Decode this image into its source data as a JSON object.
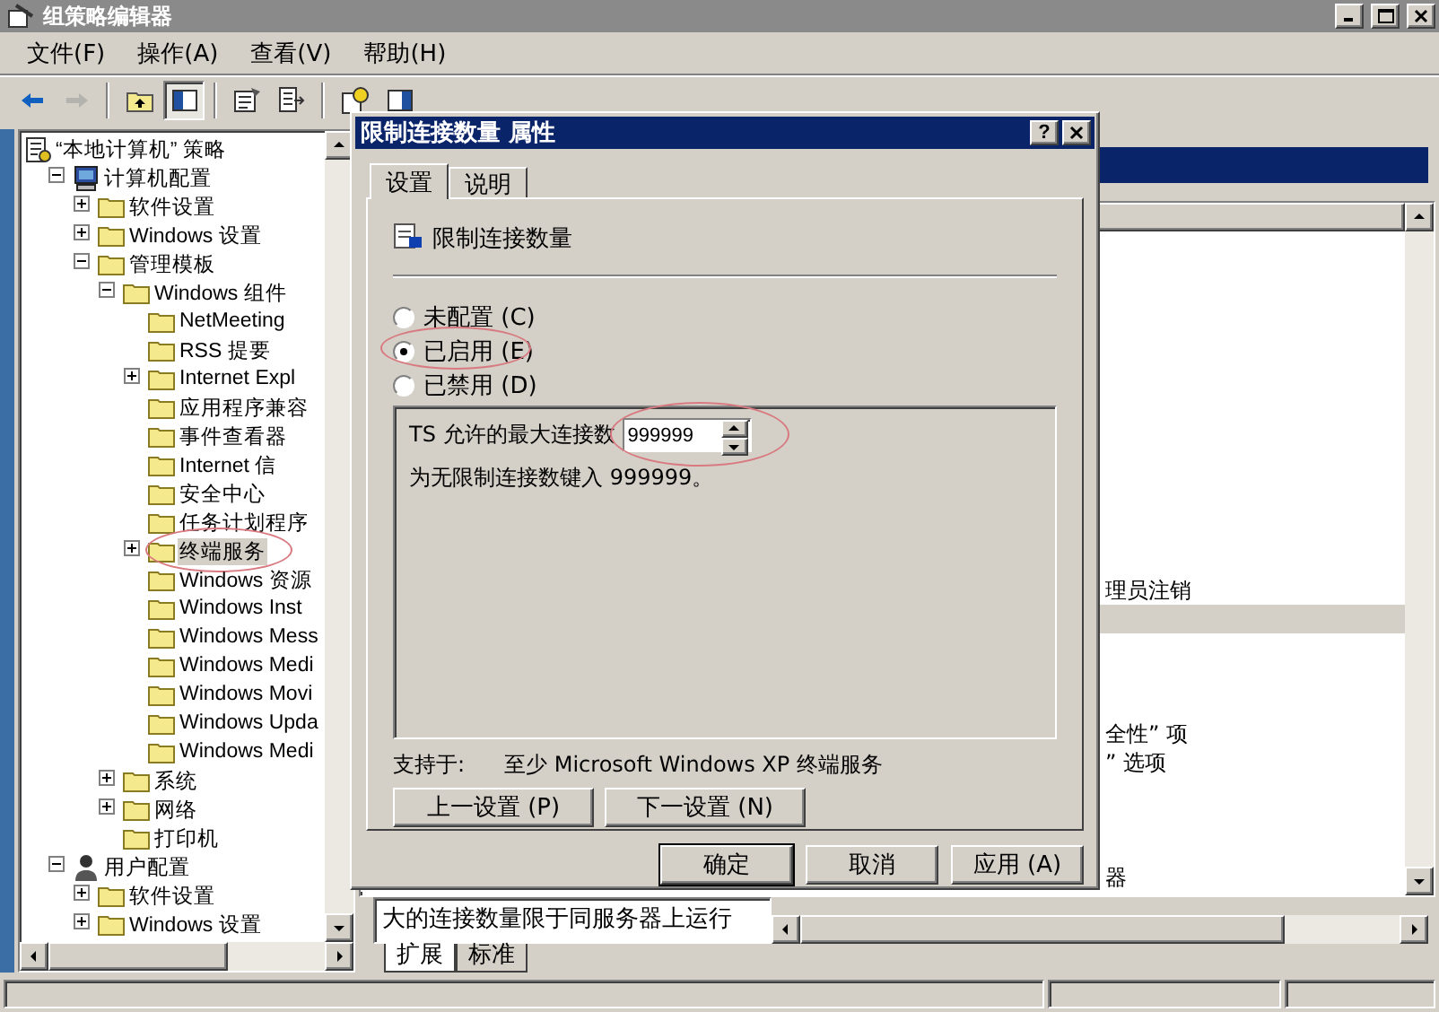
{
  "window": {
    "title": "组策略编辑器"
  },
  "menu": [
    "文件(F)",
    "操作(A)",
    "查看(V)",
    "帮助(H)"
  ],
  "toolbar": [
    [
      {
        "kind": "back",
        "disabled": false,
        "pressed": false
      },
      {
        "kind": "forward",
        "disabled": true,
        "pressed": false
      }
    ],
    [
      {
        "kind": "up",
        "disabled": false,
        "pressed": false
      },
      {
        "kind": "tree",
        "disabled": false,
        "pressed": true
      }
    ],
    [
      {
        "kind": "properties",
        "disabled": false,
        "pressed": false
      },
      {
        "kind": "export",
        "disabled": false,
        "pressed": false
      }
    ],
    [
      {
        "kind": "help",
        "disabled": false,
        "pressed": false
      },
      {
        "kind": "pane",
        "disabled": false,
        "pressed": false
      }
    ]
  ],
  "tree": [
    {
      "label": "“本地计算机” 策略",
      "kind": "policy",
      "selected": false,
      "children": [
        {
          "label": "计算机配置",
          "kind": "computer",
          "expanded": true,
          "selected": false,
          "children": [
            {
              "label": "软件设置",
              "kind": "folder",
              "expanded": false,
              "selected": false
            },
            {
              "label": "Windows 设置",
              "kind": "folder",
              "expanded": false,
              "selected": false
            },
            {
              "label": "管理模板",
              "kind": "folder",
              "expanded": true,
              "selected": false,
              "children": [
                {
                  "label": "Windows 组件",
                  "kind": "folder",
                  "expanded": true,
                  "selected": false,
                  "children": [
                    {
                      "label": "NetMeeting",
                      "kind": "folder",
                      "selected": false
                    },
                    {
                      "label": "RSS 提要",
                      "kind": "folder",
                      "selected": false
                    },
                    {
                      "label": "Internet Expl",
                      "kind": "folder",
                      "expanded": false,
                      "selected": false
                    },
                    {
                      "label": "应用程序兼容",
                      "kind": "folder",
                      "selected": false
                    },
                    {
                      "label": "事件查看器",
                      "kind": "folder",
                      "selected": false
                    },
                    {
                      "label": "Internet 信",
                      "kind": "folder",
                      "selected": false
                    },
                    {
                      "label": "安全中心",
                      "kind": "folder",
                      "selected": false
                    },
                    {
                      "label": "任务计划程序",
                      "kind": "folder",
                      "selected": false
                    },
                    {
                      "label": "终端服务",
                      "kind": "folder",
                      "expanded": false,
                      "selected": true
                    },
                    {
                      "label": "Windows 资源",
                      "kind": "folder",
                      "selected": false
                    },
                    {
                      "label": "Windows Inst",
                      "kind": "folder",
                      "selected": false
                    },
                    {
                      "label": "Windows Mess",
                      "kind": "folder",
                      "selected": false
                    },
                    {
                      "label": "Windows Medi",
                      "kind": "folder",
                      "selected": false
                    },
                    {
                      "label": "Windows Movi",
                      "kind": "folder",
                      "selected": false
                    },
                    {
                      "label": "Windows Upda",
                      "kind": "folder",
                      "selected": false
                    },
                    {
                      "label": "Windows Medi",
                      "kind": "folder",
                      "selected": false
                    }
                  ]
                },
                {
                  "label": "系统",
                  "kind": "folder",
                  "expanded": false,
                  "selected": false
                },
                {
                  "label": "网络",
                  "kind": "folder",
                  "expanded": false,
                  "selected": false
                },
                {
                  "label": "打印机",
                  "kind": "folder",
                  "selected": false
                }
              ]
            }
          ]
        },
        {
          "label": "用户配置",
          "kind": "user",
          "expanded": true,
          "selected": false,
          "children": [
            {
              "label": "软件设置",
              "kind": "folder",
              "expanded": false,
              "selected": false
            },
            {
              "label": "Windows 设置",
              "kind": "folder",
              "expanded": false,
              "selected": false
            }
          ]
        }
      ]
    }
  ],
  "right_pane": {
    "rows": [
      {
        "selected": false
      },
      {
        "selected": false
      },
      {
        "selected": false
      },
      {
        "selected": false
      },
      {
        "selected": false
      },
      {
        "selected": false
      },
      {
        "selected": false
      },
      {
        "selected": false
      },
      {
        "selected": false
      },
      {
        "selected": false
      },
      {
        "selected": false
      },
      {
        "selected": false
      },
      {
        "text": "理员注销",
        "selected": false
      },
      {
        "selected": true
      },
      {
        "selected": false
      },
      {
        "selected": false
      },
      {
        "selected": false
      },
      {
        "text": "全性” 项",
        "selected": false
      },
      {
        "text": "” 选项",
        "selected": false
      },
      {
        "selected": false
      },
      {
        "selected": false
      },
      {
        "selected": false
      },
      {
        "text": "器",
        "selected": false
      }
    ],
    "description": "大的连接数量限于同服务器上运行",
    "tabs": [
      {
        "label": "扩展",
        "selected": true
      },
      {
        "label": "标准",
        "selected": false
      }
    ]
  },
  "dialog": {
    "title": "限制连接数量 属性",
    "help_button": "?",
    "tabs": [
      {
        "label": "设置",
        "selected": true
      },
      {
        "label": "说明",
        "selected": false
      }
    ],
    "setting": "限制连接数量",
    "options": [
      {
        "label": "未配置 (C)",
        "selected": false
      },
      {
        "label": "已启用 (E)",
        "selected": true
      },
      {
        "label": "已禁用 (D)",
        "selected": false
      }
    ],
    "field": {
      "label": "TS 允许的最大连接数",
      "value": "999999"
    },
    "hint": "为无限制连接数键入 999999。",
    "supported_label": "支持于:",
    "supported": "至少 Microsoft Windows XP 终端服务",
    "nav_buttons": [
      "上一设置 (P)",
      "下一设置 (N)"
    ],
    "buttons": [
      "确定",
      "取消",
      "应用 (A)"
    ]
  }
}
